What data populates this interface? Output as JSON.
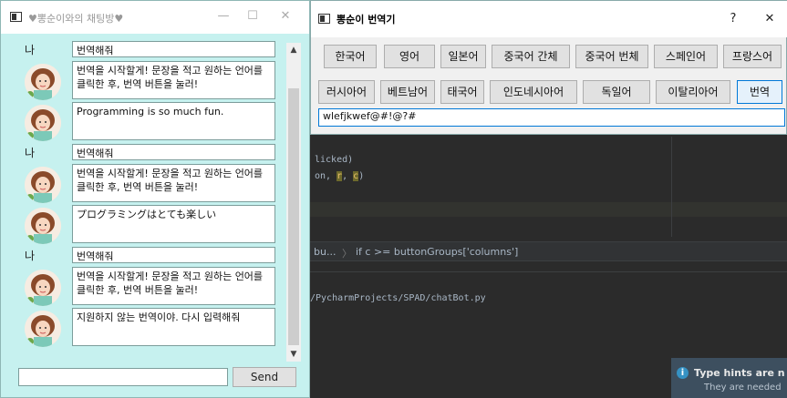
{
  "ide": {
    "code_line1": "licked)",
    "code_line2_a": "on, ",
    "code_line2_b": "r",
    "code_line2_c": ", ",
    "code_line2_d": "c",
    "code_line2_e": ")",
    "crumb_a": "bu...",
    "crumb_sep": "〉",
    "crumb_b": "if c >= buttonGroups['columns']",
    "terminal_line": "/PycharmProjects/SPAD/chatBot.py",
    "hint_title": "Type hints are n",
    "hint_sub": "They are needed"
  },
  "chat": {
    "title": "♥뽕순이와의 채팅방♥",
    "input_value": "",
    "send_label": "Send",
    "messages": [
      {
        "from": "me",
        "label": "나",
        "text": "번역해줘"
      },
      {
        "from": "bot",
        "text": "번역을 시작할게! 문장을 적고 원하는 언어를 클릭한 후, 번역 버튼을 눌러!"
      },
      {
        "from": "bot",
        "text": "Programming is so much fun."
      },
      {
        "from": "me",
        "label": "나",
        "text": "번역해줘"
      },
      {
        "from": "bot",
        "text": "번역을 시작할게! 문장을 적고 원하는 언어를 클릭한 후, 번역 버튼을 눌러!"
      },
      {
        "from": "bot",
        "text": "プログラミングはとても楽しい"
      },
      {
        "from": "me",
        "label": "나",
        "text": "번역해줘"
      },
      {
        "from": "bot",
        "text": "번역을 시작할게! 문장을 적고 원하는 언어를 클릭한 후, 번역 버튼을 눌러!"
      },
      {
        "from": "bot",
        "text": "지원하지 않는 번역이야. 다시 입력해줘"
      }
    ]
  },
  "translator": {
    "title": "뽕순이 번역기",
    "help_label": "?",
    "close_label": "✕",
    "buttons_row1": [
      "한국어",
      "영어",
      "일본어",
      "중국어 간체",
      "중국어 번체",
      "스페인어",
      "프랑스어"
    ],
    "buttons_row2": [
      "러시아어",
      "베트남어",
      "태국어",
      "인도네시아어",
      "독일어",
      "이탈리아어",
      "번역"
    ],
    "input_value": "wlefjkwef@#!@?#"
  },
  "colors": {
    "chat_bg": "#c6f1ef",
    "ide_bg": "#2b2b2b",
    "focus_blue": "#0078d7"
  }
}
